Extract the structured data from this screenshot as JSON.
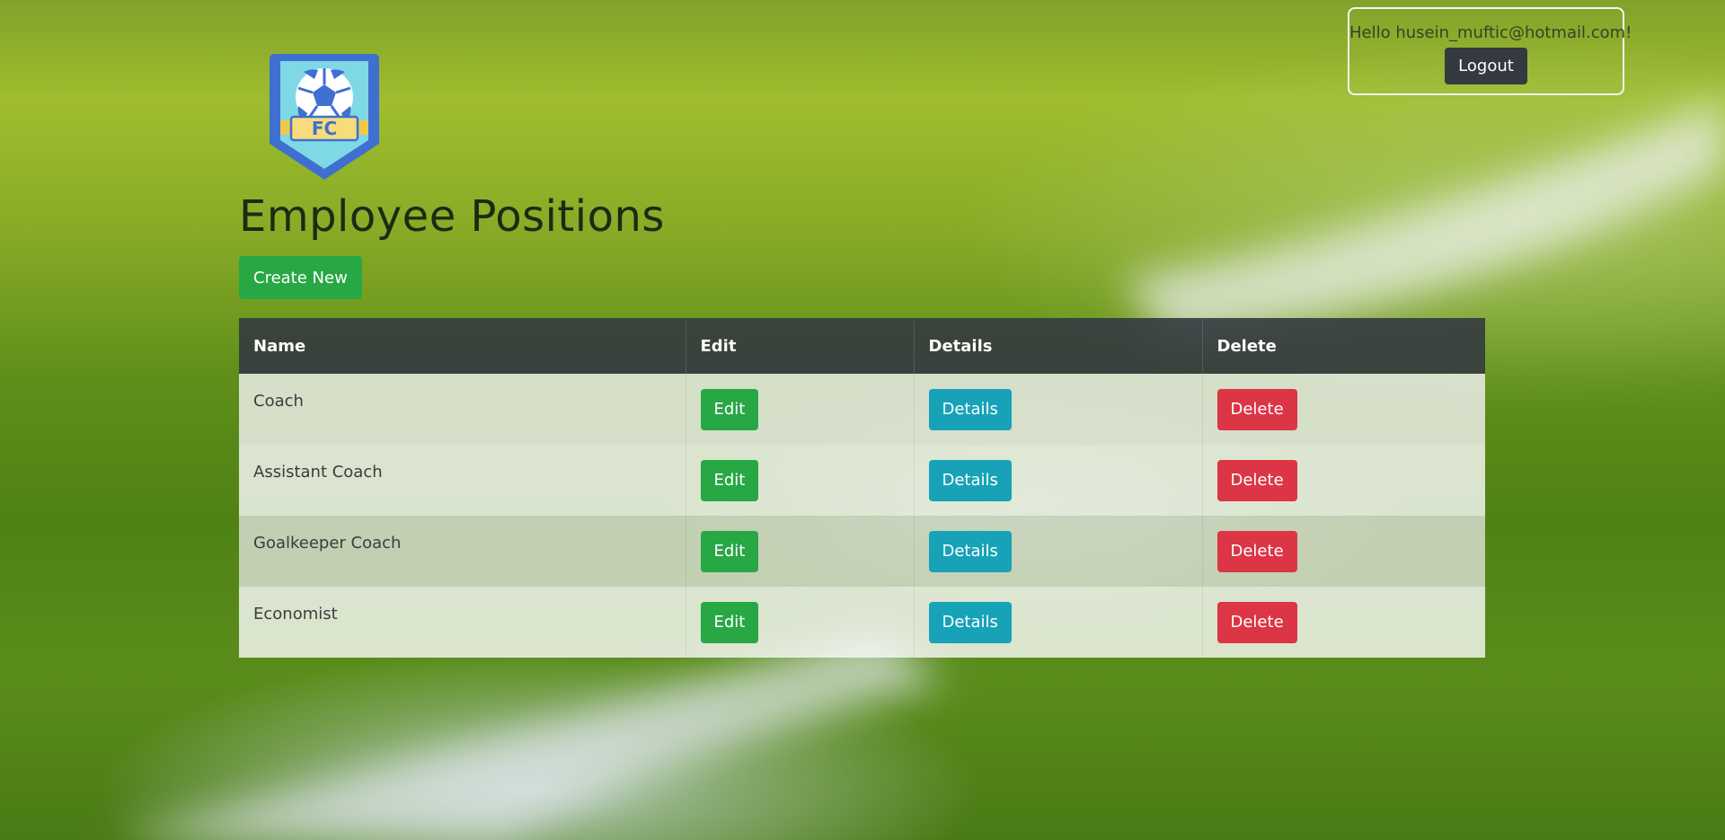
{
  "header": {
    "greeting": "Hello husein_muftic@hotmail.com!",
    "logout_label": "Logout"
  },
  "logo": {
    "text": "FC",
    "icon": "soccer-ball-shield-icon"
  },
  "page": {
    "title": "Employee Positions",
    "create_label": "Create New"
  },
  "table": {
    "columns": [
      "Name",
      "Edit",
      "Details",
      "Delete"
    ],
    "rows": [
      {
        "name": "Coach",
        "edit": "Edit",
        "details": "Details",
        "delete": "Delete"
      },
      {
        "name": "Assistant Coach",
        "edit": "Edit",
        "details": "Details",
        "delete": "Delete"
      },
      {
        "name": "Goalkeeper Coach",
        "edit": "Edit",
        "details": "Details",
        "delete": "Delete"
      },
      {
        "name": "Economist",
        "edit": "Edit",
        "details": "Details",
        "delete": "Delete"
      }
    ]
  },
  "colors": {
    "success": "#28a745",
    "info": "#17a2b8",
    "danger": "#dc3545",
    "dark": "#343a40"
  }
}
